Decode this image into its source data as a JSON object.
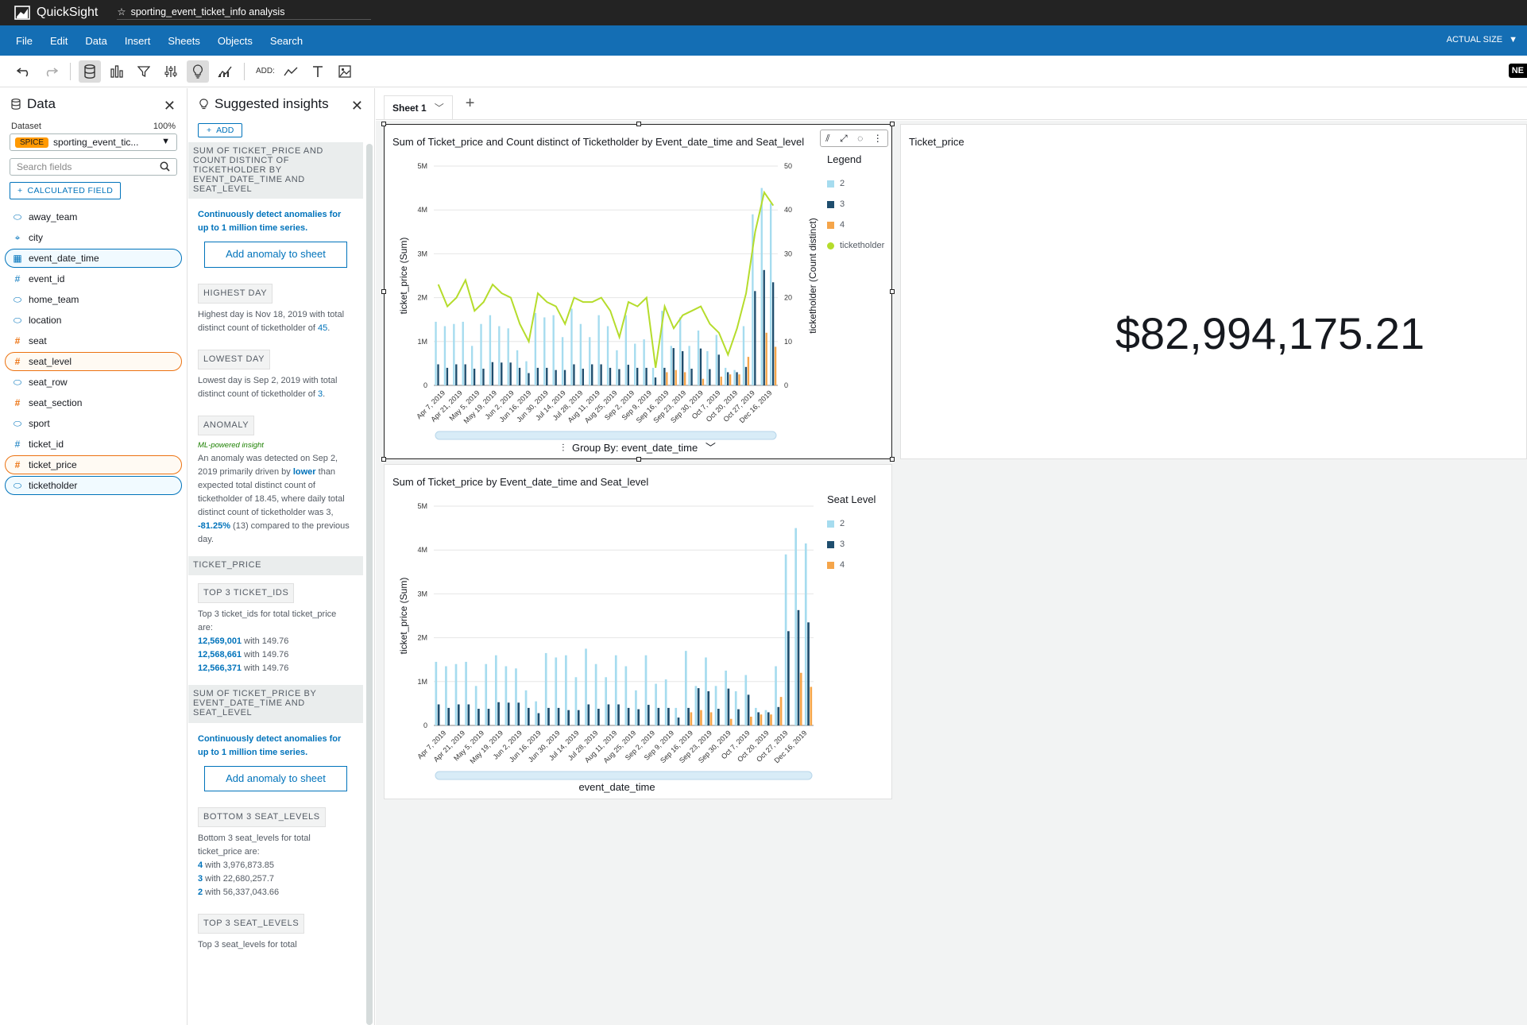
{
  "app": {
    "brand": "QuickSight",
    "analysis_title": "sporting_event_ticket_info analysis"
  },
  "menu": [
    "File",
    "Edit",
    "Data",
    "Insert",
    "Sheets",
    "Objects",
    "Search"
  ],
  "actual_size": "ACTUAL SIZE",
  "toolbar": {
    "add_label": "ADD:",
    "ne_badge": "NE"
  },
  "data_pane": {
    "title": "Data",
    "dataset_label": "Dataset",
    "dataset_pct": "100%",
    "spice_badge": "SPICE",
    "dataset_name": "sporting_event_tic...",
    "search_placeholder": "Search fields",
    "calculated_field": "CALCULATED FIELD",
    "fields": [
      {
        "name": "away_team",
        "type": "dim",
        "icon": "tag-icon"
      },
      {
        "name": "city",
        "type": "geo",
        "icon": "location-pin-icon"
      },
      {
        "name": "event_date_time",
        "type": "date",
        "icon": "calendar-icon",
        "selected": "blue"
      },
      {
        "name": "event_id",
        "type": "num",
        "icon": "hash-icon"
      },
      {
        "name": "home_team",
        "type": "dim",
        "icon": "tag-icon"
      },
      {
        "name": "location",
        "type": "dim",
        "icon": "tag-icon"
      },
      {
        "name": "seat",
        "type": "meas",
        "icon": "hash-icon"
      },
      {
        "name": "seat_level",
        "type": "meas",
        "icon": "hash-icon",
        "selected": "orange"
      },
      {
        "name": "seat_row",
        "type": "dim",
        "icon": "tag-icon"
      },
      {
        "name": "seat_section",
        "type": "meas",
        "icon": "hash-icon"
      },
      {
        "name": "sport",
        "type": "dim",
        "icon": "tag-icon"
      },
      {
        "name": "ticket_id",
        "type": "num",
        "icon": "hash-icon"
      },
      {
        "name": "ticket_price",
        "type": "meas",
        "icon": "hash-icon",
        "selected": "orange"
      },
      {
        "name": "ticketholder",
        "type": "dim",
        "icon": "tag-icon",
        "selected": "blue"
      }
    ]
  },
  "insights": {
    "title": "Suggested insights",
    "add": "ADD",
    "sec1_head": "SUM OF TICKET_PRICE AND COUNT DISTINCT OF TICKETHOLDER BY EVENT_DATE_TIME AND SEAT_LEVEL",
    "detect_text": "Continuously detect anomalies for up to 1 million time series.",
    "anomaly_btn": "Add anomaly to sheet",
    "highest_tag": "HIGHEST DAY",
    "highest_text_a": "Highest day is Nov 18, 2019 with total distinct count of ticketholder of",
    "highest_val": "45",
    "lowest_tag": "LOWEST DAY",
    "lowest_text_a": "Lowest day is Sep 2, 2019 with total distinct count of ticketholder of",
    "lowest_val": "3",
    "anomaly_tag": "ANOMALY",
    "ml_tag": "ML-powered insight",
    "anomaly_text_a": "An anomaly was detected on Sep 2, 2019 primarily driven by",
    "anomaly_lower": "lower",
    "anomaly_text_b": "than expected total distinct count of ticketholder of 18.45, where daily total distinct count of ticketholder was 3,",
    "anomaly_pct": "-81.25%",
    "anomaly_text_c": "(13) compared to the previous day.",
    "sec2_head": "TICKET_PRICE",
    "top3_tag": "TOP 3 TICKET_IDS",
    "top3_text": "Top 3 ticket_ids for total ticket_price are:",
    "top3_items": [
      {
        "id": "12,569,001",
        "rest": " with 149.76"
      },
      {
        "id": "12,568,661",
        "rest": " with 149.76"
      },
      {
        "id": "12,566,371",
        "rest": " with 149.76"
      }
    ],
    "sec3_head": "SUM OF TICKET_PRICE BY EVENT_DATE_TIME AND SEAT_LEVEL",
    "bottom3_tag": "BOTTOM 3 SEAT_LEVELS",
    "bottom3_text": "Bottom 3 seat_levels for total ticket_price are:",
    "bottom3_items": [
      {
        "id": "4",
        "rest": " with 3,976,873.85"
      },
      {
        "id": "3",
        "rest": " with 22,680,257.7"
      },
      {
        "id": "2",
        "rest": " with 56,337,043.66"
      }
    ],
    "top3lvl_tag": "TOP 3 SEAT_LEVELS",
    "top3lvl_text": "Top 3 seat_levels for total"
  },
  "sheet": {
    "tab": "Sheet 1"
  },
  "kpi": {
    "title": "Ticket_price",
    "value": "$82,994,175.21"
  },
  "colors": {
    "lvl2": "#a6dcef",
    "lvl3": "#1f4e6e",
    "lvl4": "#f5a54a",
    "line": "#b5dc2c",
    "menu": "#146eb4"
  },
  "chart_data": [
    {
      "type": "bar",
      "title": "Sum of Ticket_price and Count distinct of Ticketholder by Event_date_time and Seat_level",
      "ylabel": "ticket_price (Sum)",
      "y2label": "ticketholder (Count distinct)",
      "group_by": "Group By: event_date_time",
      "legend_title": "Legend",
      "ylim": [
        0,
        5000000
      ],
      "y2lim": [
        0,
        50
      ],
      "yticks": [
        "0",
        "1M",
        "2M",
        "3M",
        "4M",
        "5M"
      ],
      "y2ticks": [
        "0",
        "10",
        "20",
        "30",
        "40",
        "50"
      ],
      "x_tick_labels": [
        "Apr 7, 2019",
        "Apr 21, 2019",
        "May 5, 2019",
        "May 19, 2019",
        "Jun 2, 2019",
        "Jun 16, 2019",
        "Jun 30, 2019",
        "Jul 14, 2019",
        "Jul 28, 2019",
        "Aug 11, 2019",
        "Aug 25, 2019",
        "Sep 2, 2019",
        "Sep 9, 2019",
        "Sep 16, 2019",
        "Sep 23, 2019",
        "Sep 30, 2019",
        "Oct 7, 2019",
        "Oct 20, 2019",
        "Oct 27, 2019",
        "Dec 16, 2019"
      ],
      "series": [
        {
          "name": "2",
          "values": [
            1.45,
            1.35,
            1.4,
            1.45,
            0.9,
            1.4,
            1.6,
            1.35,
            1.3,
            0.8,
            0.55,
            1.65,
            1.55,
            1.6,
            1.1,
            1.75,
            1.4,
            1.1,
            1.6,
            1.35,
            0.8,
            1.6,
            0.95,
            1.05,
            0.4,
            1.7,
            0.9,
            1.55,
            0.9,
            1.25,
            0.78,
            1.15,
            0.4,
            0.35,
            1.35,
            3.9,
            4.5,
            4.15
          ]
        },
        {
          "name": "3",
          "values": [
            0.48,
            0.4,
            0.48,
            0.48,
            0.38,
            0.38,
            0.53,
            0.52,
            0.52,
            0.4,
            0.28,
            0.4,
            0.4,
            0.35,
            0.35,
            0.48,
            0.38,
            0.48,
            0.48,
            0.4,
            0.37,
            0.47,
            0.4,
            0.4,
            0.18,
            0.4,
            0.85,
            0.78,
            0.38,
            0.84,
            0.37,
            0.7,
            0.3,
            0.3,
            0.42,
            2.15,
            2.63,
            2.35
          ]
        },
        {
          "name": "4",
          "values": [
            0,
            0,
            0,
            0,
            0,
            0,
            0,
            0,
            0,
            0,
            0,
            0,
            0,
            0,
            0,
            0,
            0,
            0,
            0,
            0,
            0,
            0,
            0,
            0,
            0,
            0.3,
            0.35,
            0.3,
            0,
            0.15,
            0,
            0.2,
            0.25,
            0.25,
            0.65,
            0,
            1.2,
            0.88
          ]
        }
      ],
      "series_units": "millions",
      "line": {
        "name": "ticketholder",
        "values": [
          23,
          18,
          20,
          24,
          17,
          19,
          23,
          21,
          20,
          14,
          10,
          21,
          19,
          18,
          14,
          20,
          19,
          19,
          20,
          17,
          11,
          19,
          18,
          20,
          4,
          18,
          13,
          16,
          17,
          18,
          14,
          12,
          7,
          13,
          21,
          35,
          44,
          41
        ]
      }
    },
    {
      "type": "bar",
      "title": "Sum of Ticket_price by Event_date_time and Seat_level",
      "ylabel": "ticket_price (Sum)",
      "xlabel": "event_date_time",
      "legend_title": "Seat Level",
      "ylim": [
        0,
        5000000
      ],
      "yticks": [
        "0",
        "1M",
        "2M",
        "3M",
        "4M",
        "5M"
      ],
      "x_tick_labels": [
        "Apr 7, 2019",
        "Apr 21, 2019",
        "May 5, 2019",
        "May 19, 2019",
        "Jun 2, 2019",
        "Jun 16, 2019",
        "Jun 30, 2019",
        "Jul 14, 2019",
        "Jul 28, 2019",
        "Aug 11, 2019",
        "Aug 25, 2019",
        "Sep 2, 2019",
        "Sep 9, 2019",
        "Sep 16, 2019",
        "Sep 23, 2019",
        "Sep 30, 2019",
        "Oct 7, 2019",
        "Oct 20, 2019",
        "Oct 27, 2019",
        "Dec 16, 2019"
      ],
      "series": [
        {
          "name": "2",
          "values": [
            1.45,
            1.35,
            1.4,
            1.45,
            0.9,
            1.4,
            1.6,
            1.35,
            1.3,
            0.8,
            0.55,
            1.65,
            1.55,
            1.6,
            1.1,
            1.75,
            1.4,
            1.1,
            1.6,
            1.35,
            0.8,
            1.6,
            0.95,
            1.05,
            0.4,
            1.7,
            0.9,
            1.55,
            0.9,
            1.25,
            0.78,
            1.15,
            0.4,
            0.35,
            1.35,
            3.9,
            4.5,
            4.15
          ]
        },
        {
          "name": "3",
          "values": [
            0.48,
            0.4,
            0.48,
            0.48,
            0.38,
            0.38,
            0.53,
            0.52,
            0.52,
            0.4,
            0.28,
            0.4,
            0.4,
            0.35,
            0.35,
            0.48,
            0.38,
            0.48,
            0.48,
            0.4,
            0.37,
            0.47,
            0.4,
            0.4,
            0.18,
            0.4,
            0.85,
            0.78,
            0.38,
            0.84,
            0.37,
            0.7,
            0.3,
            0.3,
            0.42,
            2.15,
            2.63,
            2.35
          ]
        },
        {
          "name": "4",
          "values": [
            0,
            0,
            0,
            0,
            0,
            0,
            0,
            0,
            0,
            0,
            0,
            0,
            0,
            0,
            0,
            0,
            0,
            0,
            0,
            0,
            0,
            0,
            0,
            0,
            0,
            0.3,
            0.35,
            0.3,
            0,
            0.15,
            0,
            0.2,
            0.25,
            0.25,
            0.65,
            0,
            1.2,
            0.88
          ]
        }
      ],
      "series_units": "millions"
    }
  ]
}
